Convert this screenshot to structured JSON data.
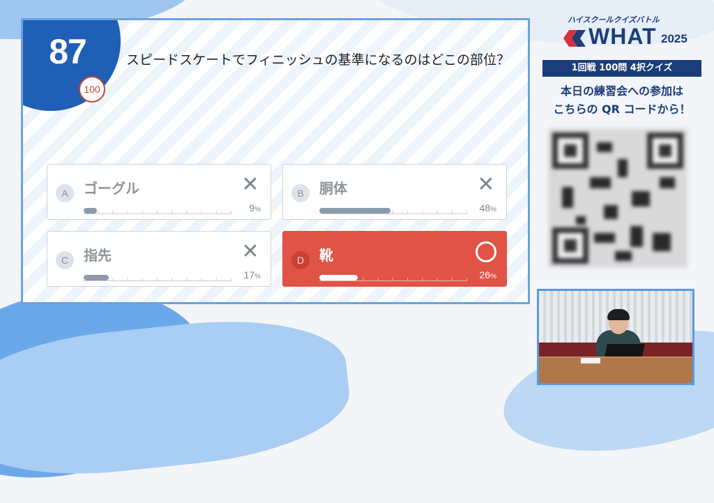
{
  "quiz": {
    "question_number": "87",
    "total_questions": "100",
    "question_text": "スピードスケートでフィニッシュの基準になるのはどこの部位？",
    "options": [
      {
        "letter": "A",
        "text": "ゴーグル",
        "percent": "9",
        "unit": "%",
        "fraction": 0.09,
        "result": "incorrect",
        "mark_icon": "cross-icon"
      },
      {
        "letter": "B",
        "text": "胴体",
        "percent": "48",
        "unit": "%",
        "fraction": 0.48,
        "result": "incorrect",
        "mark_icon": "cross-icon"
      },
      {
        "letter": "C",
        "text": "指先",
        "percent": "17",
        "unit": "%",
        "fraction": 0.17,
        "result": "incorrect",
        "mark_icon": "cross-icon"
      },
      {
        "letter": "D",
        "text": "靴",
        "percent": "26",
        "unit": "%",
        "fraction": 0.26,
        "result": "correct",
        "mark_icon": "circle-icon"
      }
    ],
    "colors": {
      "primary": "#1f5fb6",
      "correct": "#e05346",
      "frame": "#6aa3e0"
    }
  },
  "sidebar": {
    "tagline": "ハイスクールクイズバトル",
    "logo_text": "WHAT",
    "logo_year": "2025",
    "round_label": "1回戦 100問 4択クイズ",
    "invite_line1": "本日の練習会への参加は",
    "invite_line2": "こちらの QR コードから！",
    "brand_color": "#1c3d7a"
  }
}
